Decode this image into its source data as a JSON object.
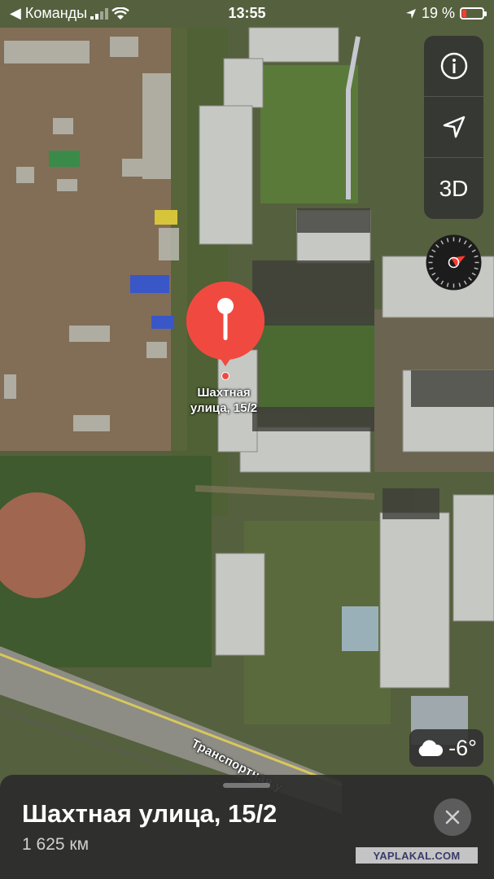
{
  "status_bar": {
    "back_app": "◀ Команды",
    "time": "13:55",
    "battery_percent": "19 %",
    "battery_level": 0.19,
    "icons": [
      "signal-bars-icon",
      "wifi-icon",
      "location-arrow-icon",
      "battery-charging-icon"
    ]
  },
  "map": {
    "type": "satellite",
    "pin": {
      "label_line1": "Шахтная",
      "label_line2": "улица, 15/2",
      "color": "#f04a40"
    },
    "road_label": "Транспортная у",
    "controls": [
      {
        "name": "info",
        "icon": "info-icon"
      },
      {
        "name": "tracking",
        "icon": "location-arrow-icon"
      },
      {
        "name": "3d",
        "label": "3D"
      }
    ],
    "compass_icon": "compass-icon",
    "weather": {
      "icon": "cloud-icon",
      "temp": "-6°"
    }
  },
  "place_card": {
    "title": "Шахтная улица, 15/2",
    "distance": "1 625 км",
    "close_icon": "close-icon"
  },
  "watermark": "YAPLAKAL.COM"
}
